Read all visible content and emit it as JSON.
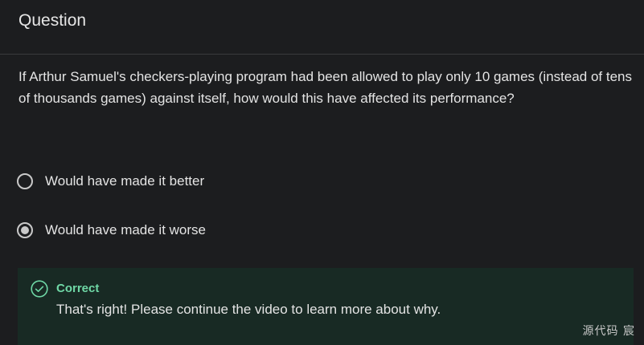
{
  "header": {
    "title": "Question"
  },
  "question": {
    "prompt": "If Arthur Samuel's checkers-playing program had been allowed to play only 10 games (instead of tens of thousands games) against itself, how would this have affected its performance?",
    "options": [
      {
        "label": "Would have made it better",
        "selected": false
      },
      {
        "label": "Would have made it worse",
        "selected": true
      }
    ]
  },
  "feedback": {
    "status": "Correct",
    "message": "That's right! Please continue the video to learn more about why.",
    "icon": "check-circle-icon",
    "accent_color": "#6fd8a6",
    "background_color": "#182a24"
  },
  "watermark": {
    "text": "源代码  宸"
  }
}
